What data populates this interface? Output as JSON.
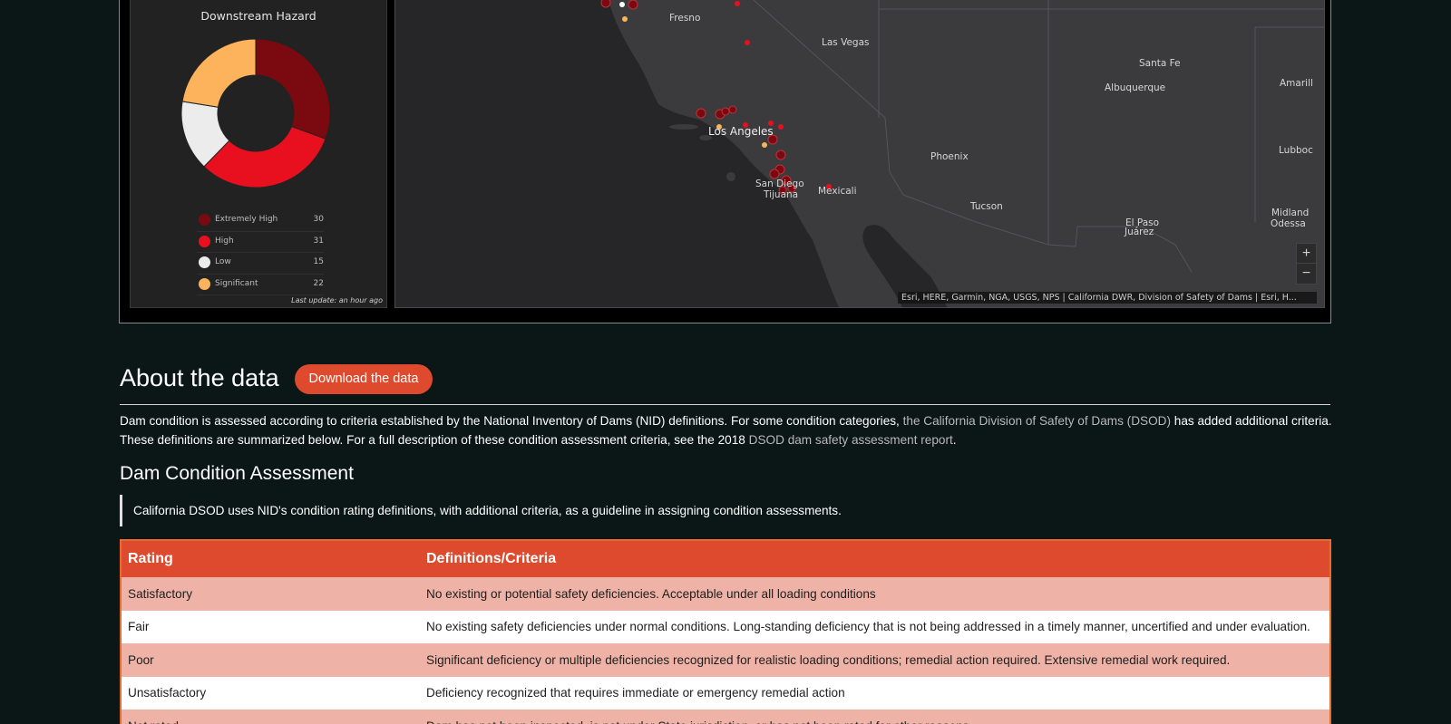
{
  "dashboard": {
    "hazard_panel": {
      "title": "Downstream Hazard",
      "last_update": "Last update: an hour ago",
      "chart_data": {
        "type": "pie",
        "categories": [
          "Extremely High",
          "High",
          "Low",
          "Significant"
        ],
        "values": [
          30,
          31,
          15,
          22
        ],
        "colors": [
          "#7a0a10",
          "#e8101e",
          "#ececec",
          "#fdb35c"
        ],
        "legend_placement": "bottom"
      },
      "legend": [
        {
          "label": "Extremely High",
          "value": "30",
          "color": "#7a0a10"
        },
        {
          "label": "High",
          "value": "31",
          "color": "#e8101e"
        },
        {
          "label": "Low",
          "value": "15",
          "color": "#ececec"
        },
        {
          "label": "Significant",
          "value": "22",
          "color": "#fdb35c"
        }
      ]
    },
    "map": {
      "cities": {
        "fresno": "Fresno",
        "las_vegas": "Las Vegas",
        "santa_fe": "Santa Fe",
        "albuquerque": "Albuquerque",
        "amarillo": "Amarill",
        "los_angeles": "Los Angeles",
        "phoenix": "Phoenix",
        "lubbock": "Lubboc",
        "san_diego": "San Diego",
        "tijuana": "Tijuana",
        "mexicali": "Mexicali",
        "tucson": "Tucson",
        "el_paso": "El Paso",
        "juarez": "Juárez",
        "midland": "Midland",
        "odessa": "Odessa"
      },
      "zoom_in": "+",
      "zoom_out": "−",
      "attribution": "Esri, HERE, Garmin, NGA, USGS, NPS | California DWR, Division of Safety of Dams | Esri, H..."
    }
  },
  "about": {
    "title": "About the data",
    "download_label": "Download the data",
    "text_part1": "Dam condition is assessed according to criteria established by the National Inventory of Dams (NID) definitions. For some condition categories, ",
    "link1": "the California Division of Safety of Dams (DSOD)",
    "text_part2": " has added additional criteria. These definitions are summarized below. For a full description of these condition assessment criteria, see the 2018 ",
    "link2": "DSOD dam safety assessment report",
    "text_part3": "."
  },
  "assessment": {
    "title": "Dam Condition Assessment",
    "quote": "California DSOD uses NID's condition rating definitions, with additional criteria, as a guideline in assigning condition assessments.",
    "table": {
      "headers": [
        "Rating",
        "Definitions/Criteria"
      ],
      "rows": [
        {
          "rating": "Satisfactory",
          "definition": "No existing or potential safety deficiencies. Acceptable under all loading conditions"
        },
        {
          "rating": "Fair",
          "definition": "No existing safety deficiencies under normal conditions. Long-standing deficiency that is not being addressed in a timely manner, uncertified and under evaluation."
        },
        {
          "rating": "Poor",
          "definition": "Significant deficiency or multiple deficiencies recognized for realistic loading conditions; remedial action required. Extensive remedial work required."
        },
        {
          "rating": "Unsatisfactory",
          "definition": "Deficiency recognized that requires immediate or emergency remedial action"
        },
        {
          "rating": "Not rated",
          "definition": "Dam has not been inspected, is not under State jurisdiction, or has not been rated for other reasons"
        }
      ]
    }
  }
}
